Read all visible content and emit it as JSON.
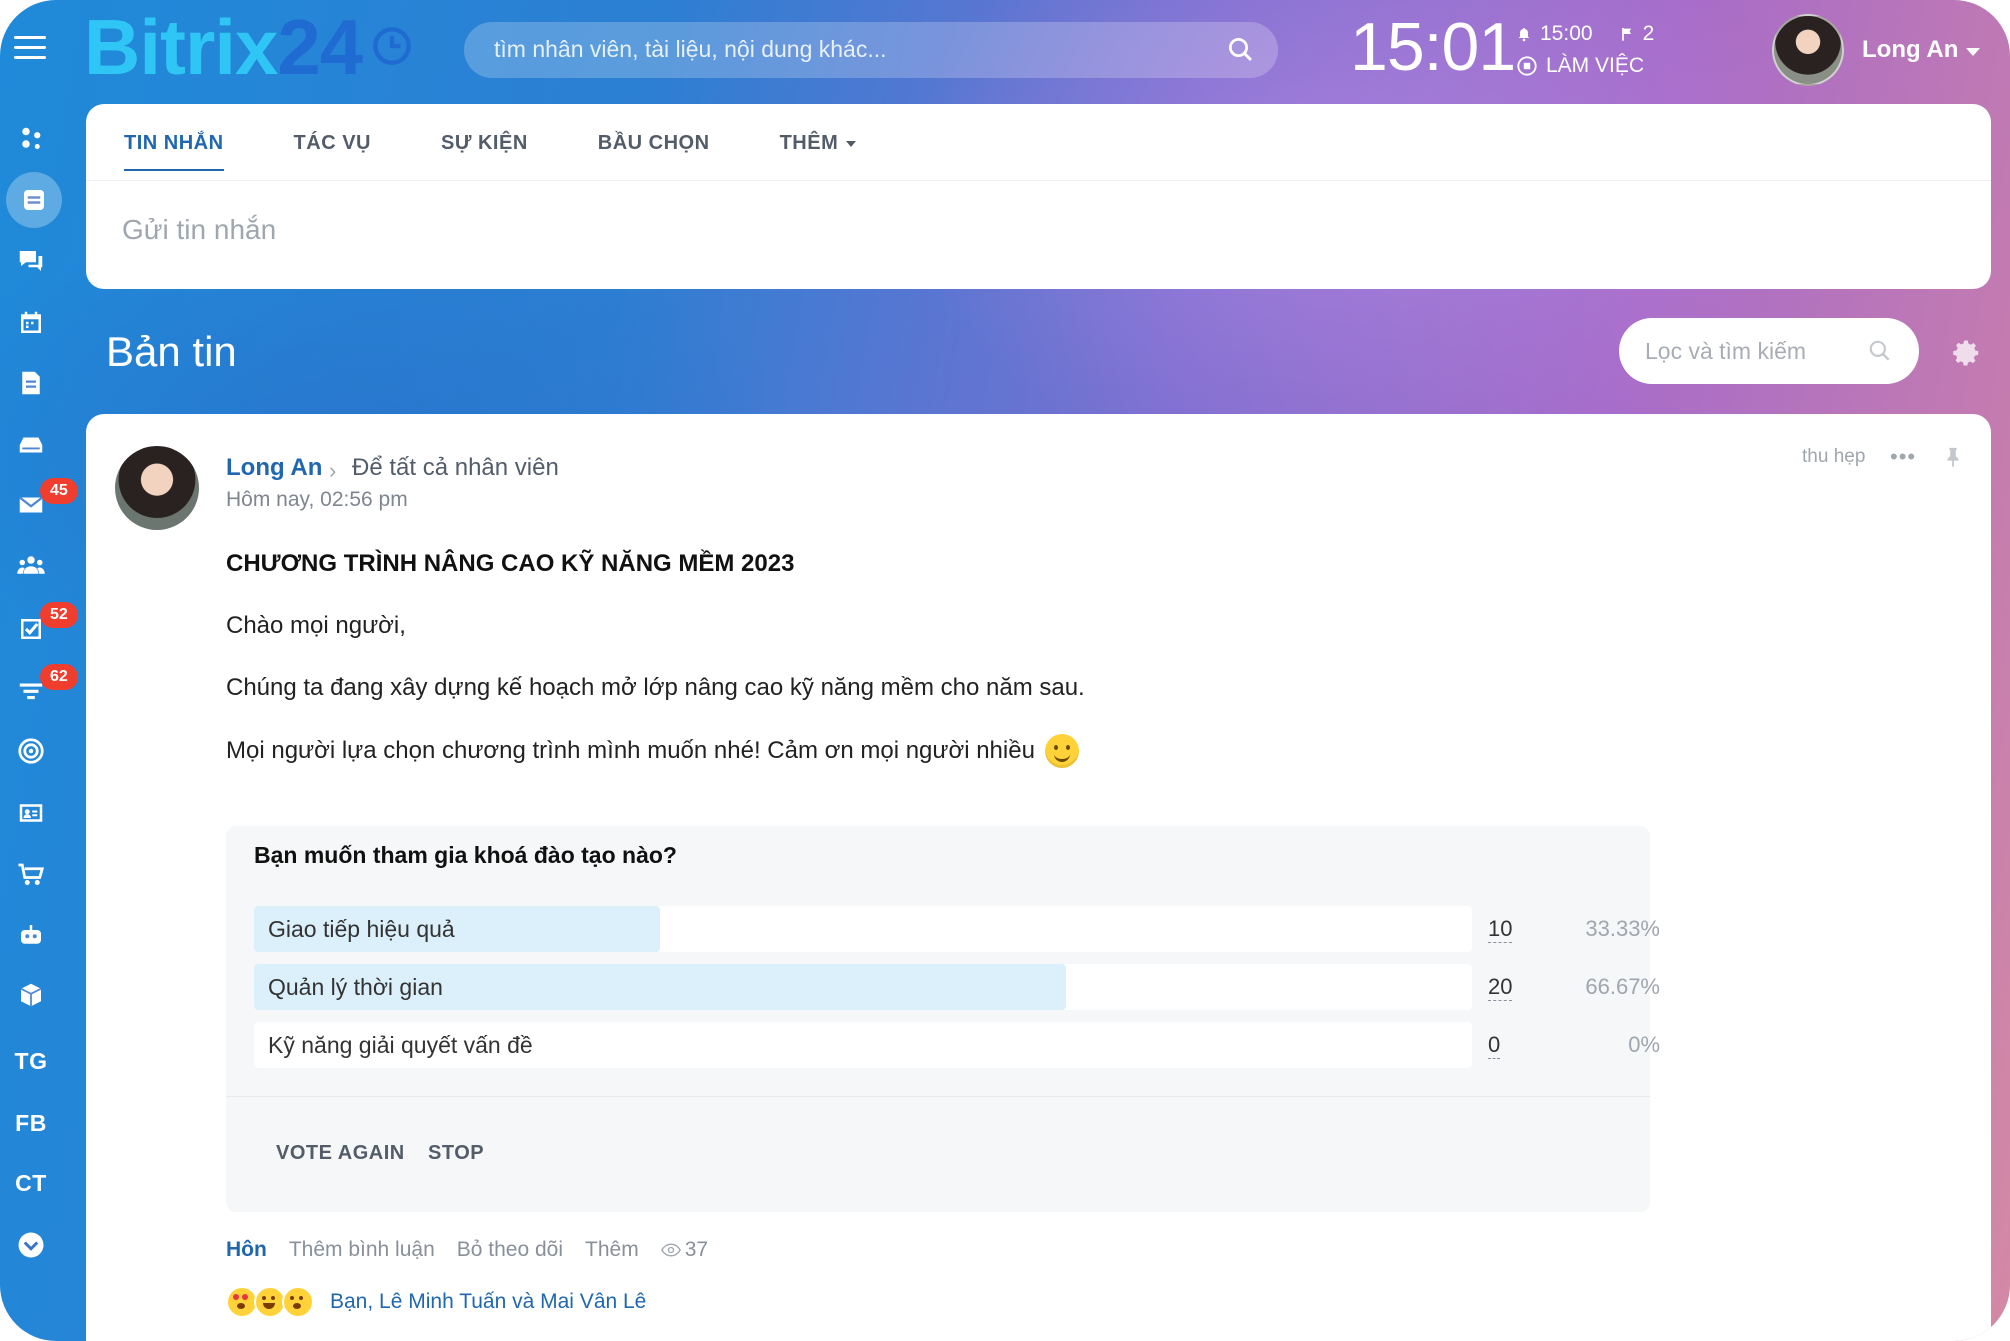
{
  "header": {
    "logo_part1": "Bitrix",
    "logo_part2": "24",
    "search_placeholder": "tìm nhân viên, tài liệu, nội dung khác...",
    "clock": "15:01",
    "alarm_time": "15:00",
    "flag_count": "2",
    "work_status": "LÀM VIỆC",
    "user_name": "Long An"
  },
  "sidebar": {
    "badges": {
      "mail": "45",
      "tasks": "52",
      "crm": "62"
    },
    "text_items": [
      "TG",
      "FB",
      "CT"
    ]
  },
  "composer": {
    "tabs": [
      "TIN NHẮN",
      "TÁC VỤ",
      "SỰ KIỆN",
      "BẦU CHỌN",
      "THÊM"
    ],
    "active_tab": "TIN NHẮN",
    "placeholder": "Gửi tin nhắn"
  },
  "feed": {
    "title": "Bản tin",
    "filter_placeholder": "Lọc và tìm kiếm"
  },
  "post": {
    "author": "Long An",
    "destination": "Để tất cả nhân viên",
    "time": "Hôm nay, 02:56 pm",
    "collapse_label": "thu hẹp",
    "title": "CHƯƠNG TRÌNH NÂNG CAO KỸ NĂNG MỀM 2023",
    "paragraphs": [
      "Chào mọi người,",
      "Chúng ta đang xây dựng kế hoạch mở lớp nâng cao kỹ năng mềm cho năm sau.",
      "Mọi người lựa chọn chương trình mình muốn nhé! Cảm ơn mọi người nhiều"
    ],
    "poll": {
      "question": "Bạn muốn tham gia khoá đào tạo nào?",
      "options": [
        {
          "label": "Giao tiếp hiệu quả",
          "count": "10",
          "percent": "33.33%",
          "fraction": 0.3333
        },
        {
          "label": "Quản lý thời gian",
          "count": "20",
          "percent": "66.67%",
          "fraction": 0.6667
        },
        {
          "label": "Kỹ năng giải quyết vấn đề",
          "count": "0",
          "percent": "0%",
          "fraction": 0
        }
      ],
      "vote_again_label": "VOTE AGAIN",
      "stop_label": "STOP"
    },
    "actions": {
      "like": "Hôn",
      "comment": "Thêm bình luận",
      "unfollow": "Bỏ theo dõi",
      "more": "Thêm",
      "views": "37"
    },
    "reactions_text": "Bạn, Lê Minh Tuấn và Mai Vân Lê"
  }
}
